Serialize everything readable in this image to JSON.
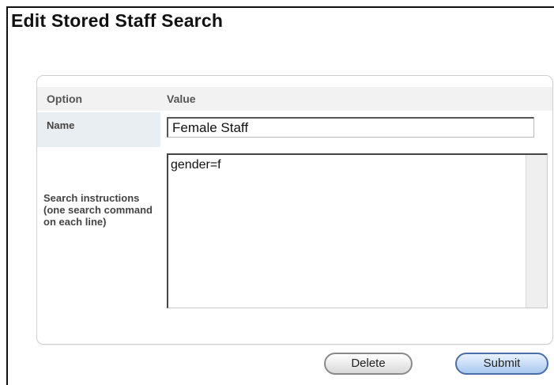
{
  "page": {
    "title": "Edit Stored Staff Search"
  },
  "table": {
    "header_option": "Option",
    "header_value": "Value",
    "rows": [
      {
        "label": "Name",
        "value": "Female Staff"
      },
      {
        "label": "Search instructions (one search command on each line)",
        "value": "gender=f"
      }
    ]
  },
  "buttons": {
    "delete_label": "Delete",
    "submit_label": "Submit"
  },
  "colors": {
    "label_cell_bg": "#e9eef3",
    "header_bg": "#f2f2f2",
    "submit_accent": "#a9c9ef"
  }
}
